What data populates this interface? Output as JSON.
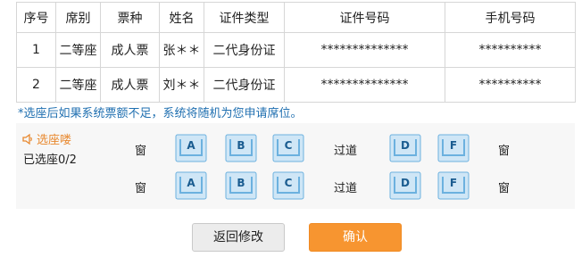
{
  "table": {
    "headers": [
      "序号",
      "席别",
      "票种",
      "姓名",
      "证件类型",
      "证件号码",
      "手机号码"
    ],
    "rows": [
      [
        "1",
        "二等座",
        "成人票",
        "张＊＊",
        "二代身份证",
        "**************",
        "**********"
      ],
      [
        "2",
        "二等座",
        "成人票",
        "刘＊＊",
        "二代身份证",
        "**************",
        "**********"
      ]
    ]
  },
  "note": "*选座后如果系统票额不足，系统将随机为您申请席位。",
  "seat_panel": {
    "title": "选座喽",
    "selected": "已选座0/2",
    "window_label": "窗",
    "aisle_label": "过道",
    "rows": [
      [
        "A",
        "B",
        "C",
        "D",
        "F"
      ],
      [
        "A",
        "B",
        "C",
        "D",
        "F"
      ]
    ]
  },
  "buttons": {
    "back": "返回修改",
    "confirm": "确认"
  },
  "colors": {
    "accent": "#f79530",
    "note_blue": "#1f6fb0",
    "seat_fill": "#cfe6f6",
    "seat_stroke": "#6cb1df"
  },
  "icons": {
    "title_icon": "speaker-icon",
    "seat_icon": "seat-icon"
  }
}
